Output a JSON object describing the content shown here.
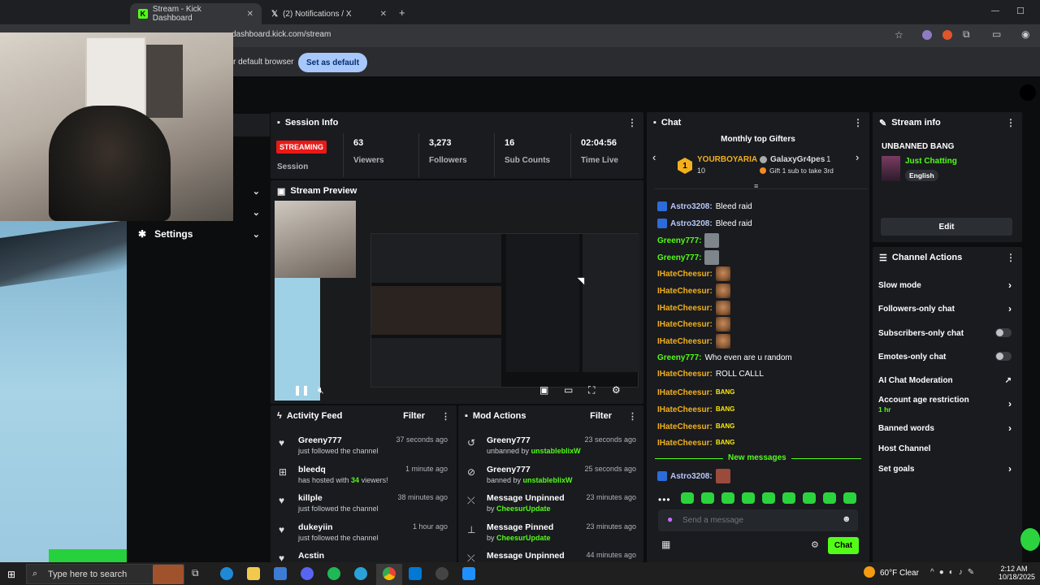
{
  "browser": {
    "tabs": [
      {
        "title": "Stream - Kick Dashboard",
        "active": true
      },
      {
        "title": "(2) Notifications / X",
        "active": false
      }
    ],
    "url": "dashboard.kick.com/stream",
    "infobar_text": "r default browser",
    "set_default_label": "Set as default"
  },
  "sidebar": {
    "settings_label": "Settings"
  },
  "session": {
    "title": "Session Info",
    "status": "STREAMING",
    "status_label": "Session",
    "viewers": "63",
    "viewers_label": "Viewers",
    "followers": "3,273",
    "followers_label": "Followers",
    "subs": "16",
    "subs_label": "Sub Counts",
    "time": "02:04:56",
    "time_label": "Time Live"
  },
  "preview": {
    "title": "Stream Preview"
  },
  "activity": {
    "title": "Activity Feed",
    "filter": "Filter",
    "items": [
      {
        "name": "Greeny777",
        "desc": "just followed the channel",
        "time": "37 seconds ago",
        "icon": "heart-icon"
      },
      {
        "name": "bleedq",
        "desc_pre": "has hosted with ",
        "desc_num": "34",
        "desc_post": " viewers!",
        "time": "1 minute ago",
        "icon": "host-icon"
      },
      {
        "name": "killple",
        "desc": "just followed the channel",
        "time": "38 minutes ago",
        "icon": "heart-icon"
      },
      {
        "name": "dukeyiin",
        "desc": "just followed the channel",
        "time": "1 hour ago",
        "icon": "heart-icon"
      },
      {
        "name": "Acstin",
        "desc": "",
        "time": "",
        "icon": "heart-icon"
      }
    ]
  },
  "mod": {
    "title": "Mod Actions",
    "filter": "Filter",
    "items": [
      {
        "name": "Greeny777",
        "desc": "unbanned by ",
        "by": "unstableblixW",
        "time": "23 seconds ago",
        "icon": "undo-icon"
      },
      {
        "name": "Greeny777",
        "desc": "banned by ",
        "by": "unstableblixW",
        "time": "25 seconds ago",
        "icon": "ban-icon"
      },
      {
        "name": "Message Unpinned",
        "desc": "by ",
        "by": "CheesurUpdate",
        "time": "23 minutes ago",
        "icon": "unpin-icon"
      },
      {
        "name": "Message Pinned",
        "desc": "by ",
        "by": "CheesurUpdate",
        "time": "23 minutes ago",
        "icon": "pin-icon"
      },
      {
        "name": "Message Unpinned",
        "desc": "",
        "by": "",
        "time": "44 minutes ago",
        "icon": "unpin-icon"
      }
    ]
  },
  "chat": {
    "title": "Chat",
    "gifters_title": "Monthly top Gifters",
    "top_gifter": {
      "rank": "1",
      "name": "YOURBOYARIA",
      "count": "10"
    },
    "second_gifter": {
      "name": "GalaxyGr4pes",
      "count": "1",
      "hint": "Gift 1 sub to take 3rd"
    },
    "messages": [
      {
        "user": "Astro3208:",
        "text": "Bleed raid"
      },
      {
        "user": "Astro3208:",
        "text": "Bleed raid"
      },
      {
        "user": "Greeny777:",
        "text": ""
      },
      {
        "user": "Greeny777:",
        "text": ""
      },
      {
        "user": "IHateCheesur:",
        "text": ""
      },
      {
        "user": "IHateCheesur:",
        "text": ""
      },
      {
        "user": "IHateCheesur:",
        "text": ""
      },
      {
        "user": "IHateCheesur:",
        "text": ""
      },
      {
        "user": "IHateCheesur:",
        "text": ""
      },
      {
        "user": "Greeny777:",
        "text": "Who even are u random"
      },
      {
        "user": "IHateCheesur:",
        "text": "ROLL CALLL"
      },
      {
        "user": "IHateCheesur:",
        "text": "BANG"
      },
      {
        "user": "IHateCheesur:",
        "text": "BANG"
      },
      {
        "user": "IHateCheesur:",
        "text": "BANG"
      },
      {
        "user": "IHateCheesur:",
        "text": "BANG"
      }
    ],
    "new_messages": "New messages",
    "last_user": "Astro3208:",
    "placeholder": "Send a message",
    "send_label": "Chat"
  },
  "stream_info": {
    "title": "Stream info",
    "stream_title": "UNBANNED BANG",
    "category": "Just Chatting",
    "language": "English",
    "edit_label": "Edit"
  },
  "channel_actions": {
    "title": "Channel Actions",
    "items": [
      {
        "label": "Slow mode",
        "control": "chevron"
      },
      {
        "label": "Followers-only chat",
        "control": "chevron"
      },
      {
        "label": "Subscribers-only chat",
        "control": "toggle"
      },
      {
        "label": "Emotes-only chat",
        "control": "toggle"
      },
      {
        "label": "AI Chat Moderation",
        "control": "external"
      },
      {
        "label": "Account age restriction",
        "sub": "1 hr",
        "control": "chevron"
      },
      {
        "label": "Banned words",
        "control": "chevron"
      },
      {
        "label": "Host Channel",
        "control": "none"
      },
      {
        "label": "Set goals",
        "control": "chevron"
      }
    ]
  },
  "taskbar": {
    "search_placeholder": "Type here to search",
    "weather": "60°F  Clear",
    "time": "2:12 AM",
    "date": "10/18/2025"
  },
  "colors": {
    "kick_green": "#53fc18",
    "panel": "#191b1f",
    "streaming_red": "#e91916"
  }
}
